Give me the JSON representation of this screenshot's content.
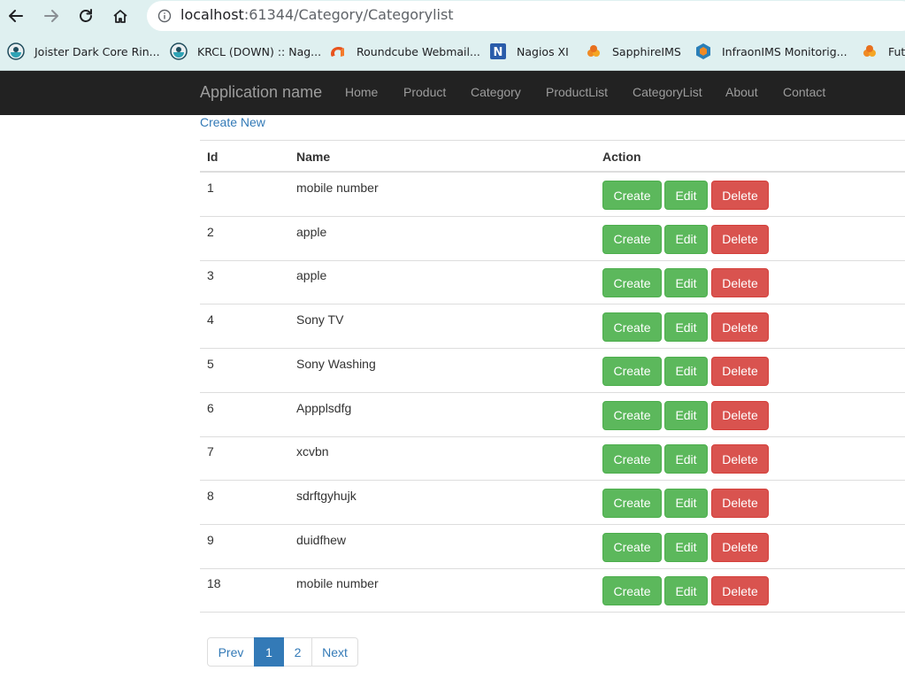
{
  "browser": {
    "url_host": "localhost",
    "url_path": ":61344/Category/Categorylist",
    "bookmarks": [
      {
        "label": "Joister Dark Core Rin...",
        "icon": "joister-icon"
      },
      {
        "label": "KRCL (DOWN) :: Nag...",
        "icon": "krcl-icon"
      },
      {
        "label": "Roundcube Webmail...",
        "icon": "roundcube-icon"
      },
      {
        "label": "Nagios XI",
        "icon": "nagios-icon"
      },
      {
        "label": "SapphireIMS",
        "icon": "sapphire-icon"
      },
      {
        "label": "InfraonIMS Monitorig...",
        "icon": "infraon-icon"
      },
      {
        "label": "Futu",
        "icon": "futu-icon"
      }
    ]
  },
  "navbar": {
    "brand": "Application name",
    "links": [
      "Home",
      "Product",
      "Category",
      "ProductList",
      "CategoryList",
      "About",
      "Contact"
    ]
  },
  "content": {
    "create_new": "Create New",
    "columns": {
      "id": "Id",
      "name": "Name",
      "action": "Action"
    },
    "rows": [
      {
        "id": "1",
        "name": "mobile number"
      },
      {
        "id": "2",
        "name": "apple"
      },
      {
        "id": "3",
        "name": "apple"
      },
      {
        "id": "4",
        "name": "Sony TV"
      },
      {
        "id": "5",
        "name": "Sony Washing"
      },
      {
        "id": "6",
        "name": "Appplsdfg"
      },
      {
        "id": "7",
        "name": "xcvbn"
      },
      {
        "id": "8",
        "name": "sdrftgyhujk"
      },
      {
        "id": "9",
        "name": "duidfhew"
      },
      {
        "id": "18",
        "name": "mobile number"
      }
    ],
    "actions": {
      "create": "Create",
      "edit": "Edit",
      "delete": "Delete"
    }
  },
  "pagination": {
    "prev": "Prev",
    "pages": [
      "1",
      "2"
    ],
    "current": "1",
    "next": "Next"
  },
  "colors": {
    "success": "#5cb85c",
    "danger": "#d9534f",
    "link": "#337ab7",
    "navbar": "#222222"
  }
}
